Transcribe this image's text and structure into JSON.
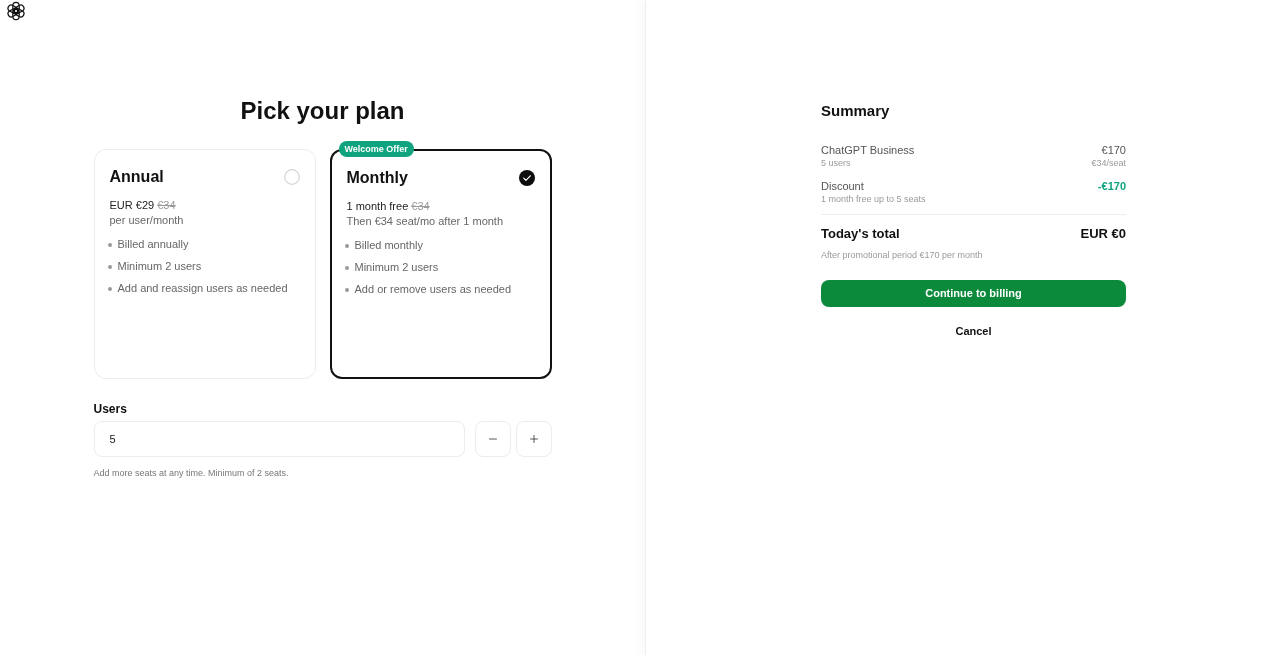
{
  "heading": "Pick your plan",
  "plans": [
    {
      "name": "Annual",
      "selected": false,
      "price": "EUR €29",
      "old_price": "€34",
      "subtitle": "per user/month",
      "features": [
        "Billed annually",
        "Minimum 2 users",
        "Add and reassign users as needed"
      ]
    },
    {
      "name": "Monthly",
      "selected": true,
      "badge": "Welcome Offer",
      "price": "1 month free",
      "old_price": "€34",
      "subtitle": "Then €34 seat/mo after 1 month",
      "features": [
        "Billed monthly",
        "Minimum 2 users",
        "Add or remove users as needed"
      ]
    }
  ],
  "users": {
    "label": "Users",
    "value": "5",
    "hint": "Add more seats at any time. Minimum of 2 seats."
  },
  "summary": {
    "title": "Summary",
    "lines": [
      {
        "kind": "charge",
        "name": "ChatGPT Business",
        "detail": "5 users",
        "amount": "€170",
        "amount_detail": "€34/seat"
      },
      {
        "kind": "discount",
        "name": "Discount",
        "detail": "1 month free up to 5 seats",
        "amount": "-€170"
      }
    ],
    "total": {
      "label": "Today's total",
      "amount": "EUR €0",
      "note": "After promotional period €170 per month"
    },
    "primary_button": "Continue to billing",
    "cancel_button": "Cancel"
  }
}
